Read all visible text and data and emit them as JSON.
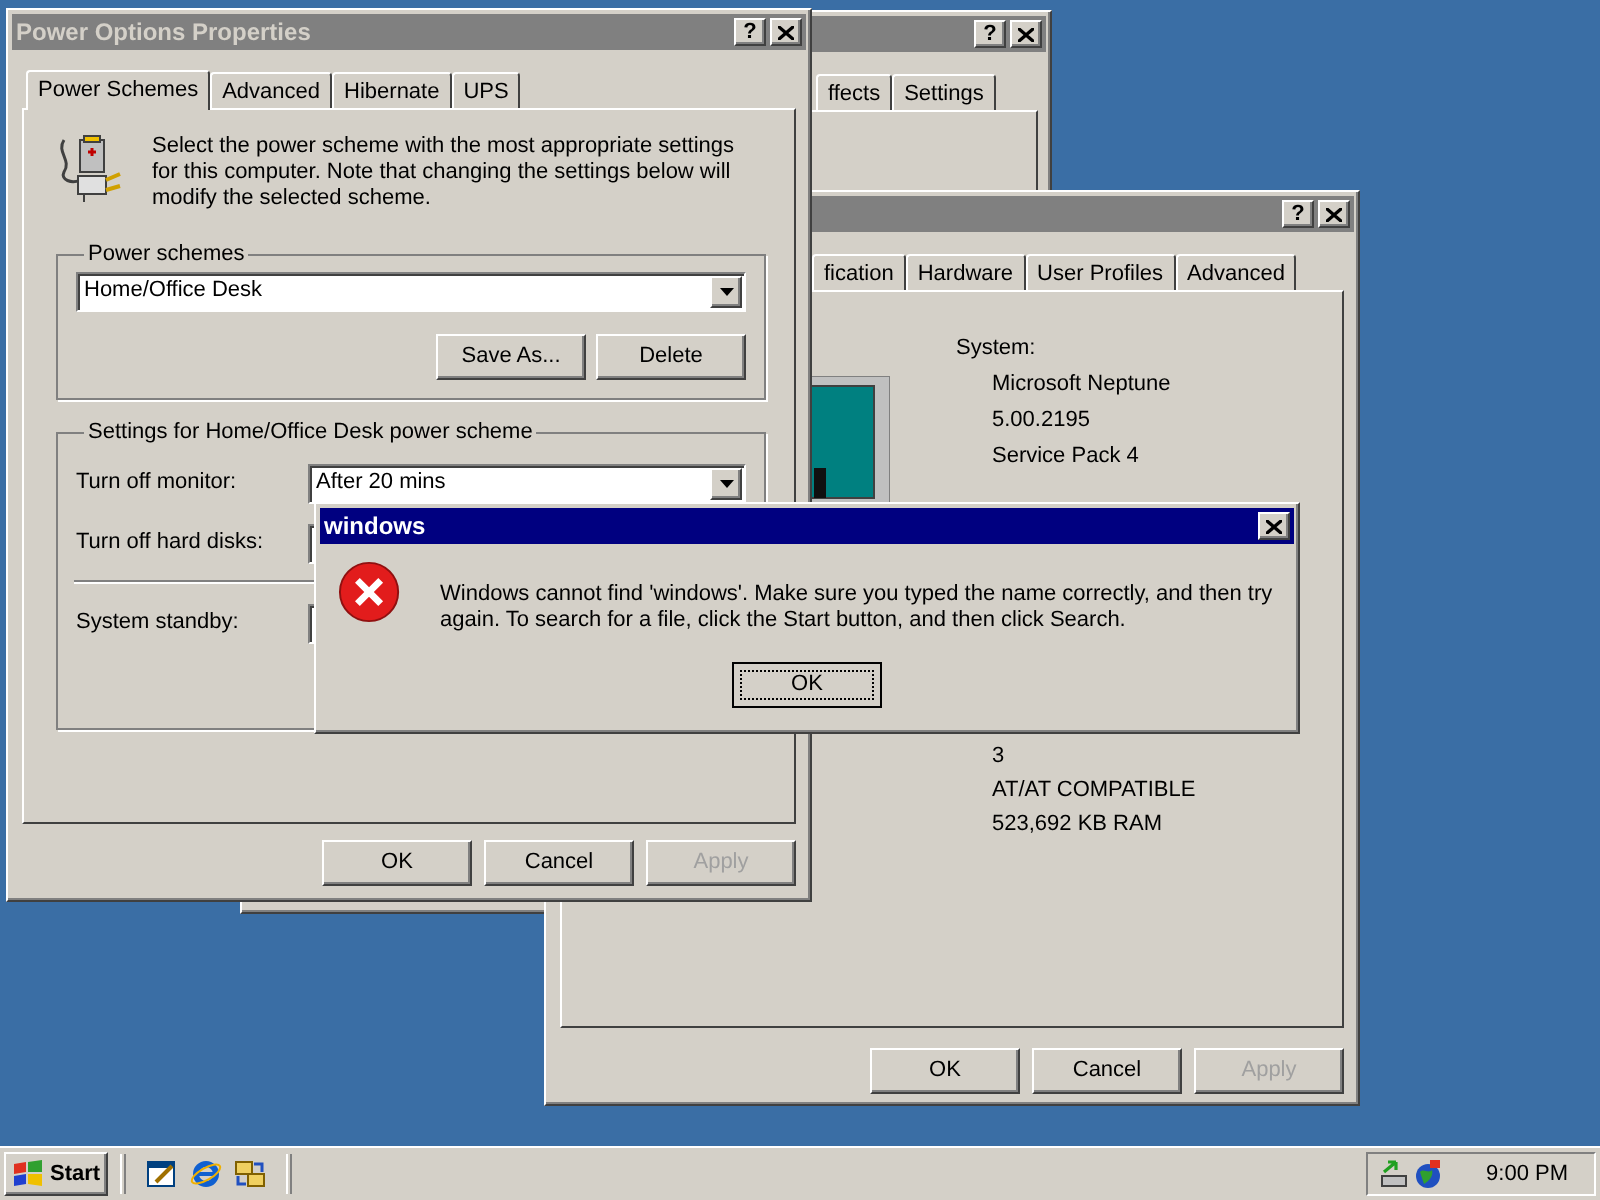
{
  "display_window": {
    "active": false,
    "help": "?",
    "tabs": [
      {
        "label": "ffects",
        "selected": false
      },
      {
        "label": "Settings",
        "selected": false
      }
    ]
  },
  "system_window": {
    "active": false,
    "help": "?",
    "tabs": [
      {
        "label": "fication",
        "selected": false
      },
      {
        "label": "Hardware",
        "selected": false
      },
      {
        "label": "User Profiles",
        "selected": false
      },
      {
        "label": "Advanced",
        "selected": false
      }
    ],
    "system_label": "System:",
    "system_lines": [
      "Microsoft Neptune",
      "5.00.2195",
      "Service Pack 4"
    ],
    "computer_lines": [
      "3",
      "AT/AT COMPATIBLE",
      "523,692 KB RAM"
    ],
    "buttons": [
      {
        "label": "OK",
        "disabled": false
      },
      {
        "label": "Cancel",
        "disabled": false
      },
      {
        "label": "Apply",
        "disabled": true
      }
    ]
  },
  "power_window": {
    "title": "Power Options Properties",
    "active": false,
    "help": "?",
    "tabs": [
      {
        "label": "Power Schemes",
        "selected": true
      },
      {
        "label": "Advanced",
        "selected": false
      },
      {
        "label": "Hibernate",
        "selected": false
      },
      {
        "label": "UPS",
        "selected": false
      }
    ],
    "intro": "Select the power scheme with the most appropriate settings for this computer. Note that changing the settings below will modify the selected scheme.",
    "schemes_group": {
      "legend": "Power schemes",
      "value": "Home/Office Desk",
      "buttons": [
        {
          "label": "Save As...",
          "disabled": false
        },
        {
          "label": "Delete",
          "disabled": false
        }
      ]
    },
    "settings_group": {
      "legend": "Settings for Home/Office Desk power scheme",
      "rows": [
        {
          "label": "Turn off monitor:",
          "value": "After 20 mins"
        },
        {
          "label": "Turn off hard disks:"
        },
        {
          "label": "System standby:",
          "separated": true
        }
      ]
    },
    "buttons": [
      {
        "label": "OK",
        "disabled": false
      },
      {
        "label": "Cancel",
        "disabled": false
      },
      {
        "label": "Apply",
        "disabled": true
      }
    ]
  },
  "error_dialog": {
    "title": "windows",
    "active": true,
    "message": "Windows cannot find 'windows'. Make sure you typed the name correctly, and then try again. To search for a file, click the Start button, and then click Search.",
    "buttons": [
      {
        "label": "OK",
        "focused": true
      }
    ]
  },
  "taskbar": {
    "start": "Start",
    "clock": "9:00 PM"
  }
}
